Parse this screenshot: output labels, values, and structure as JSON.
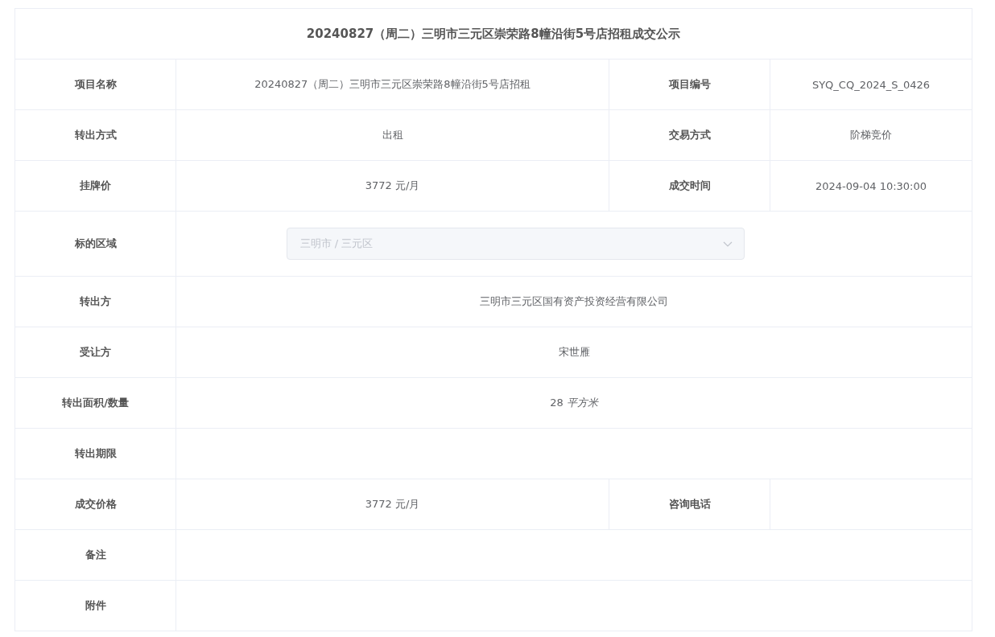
{
  "title": "20240827（周二）三明市三元区崇荣路8幢沿街5号店招租成交公示",
  "rows": [
    {
      "kind": "pair",
      "label": "项目名称",
      "value": "20240827（周二）三明市三元区崇荣路8幢沿街5号店招租",
      "label_2": "项目编号",
      "value_2": "SYQ_CQ_2024_S_0426"
    },
    {
      "kind": "pair",
      "label": "转出方式",
      "value": "出租",
      "label_2": "交易方式",
      "value_2": "阶梯竞价"
    },
    {
      "kind": "pair",
      "label": "挂牌价",
      "value": "3772 元/月",
      "label_2": "成交时间",
      "value_2": "2024-09-04 10:30:00"
    },
    {
      "kind": "select",
      "label": "标的区域",
      "value": "三明市 / 三元区",
      "disabled": true
    },
    {
      "kind": "full",
      "label": "转出方",
      "value": "三明市三元区国有资产投资经营有限公司"
    },
    {
      "kind": "full",
      "label": "受让方",
      "value": "宋世雁"
    },
    {
      "kind": "full",
      "label": "转出面积/数量",
      "value": "28 *平方米*"
    },
    {
      "kind": "full",
      "label": "转出期限"
    },
    {
      "kind": "pair",
      "label": "成交价格",
      "value": "3772 元/月",
      "label_2": "咨询电话"
    },
    {
      "kind": "full",
      "label": "备注"
    },
    {
      "kind": "full",
      "label": "附件"
    }
  ]
}
